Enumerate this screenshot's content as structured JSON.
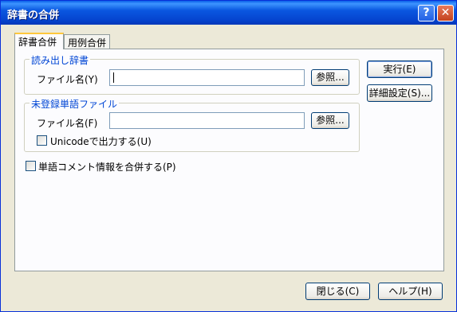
{
  "window": {
    "title": "辞書の合併",
    "help_icon": "?",
    "close_icon": "✕"
  },
  "tabs": [
    {
      "label": "辞書合併"
    },
    {
      "label": "用例合併"
    }
  ],
  "group_reading": {
    "legend": "読み出し辞書",
    "file_label": "ファイル名(Y)",
    "file_value": "",
    "browse": "参照..."
  },
  "group_unregistered": {
    "legend": "未登録単語ファイル",
    "file_label": "ファイル名(F)",
    "file_value": "",
    "browse": "参照...",
    "unicode_check": "Unicodeで出力する(U)"
  },
  "merge_comment_check": "単語コメント情報を合併する(P)",
  "side_buttons": {
    "run": "実行(E)",
    "detail": "詳細設定(S)..."
  },
  "footer": {
    "close": "閉じる(C)",
    "help": "ヘルプ(H)"
  }
}
